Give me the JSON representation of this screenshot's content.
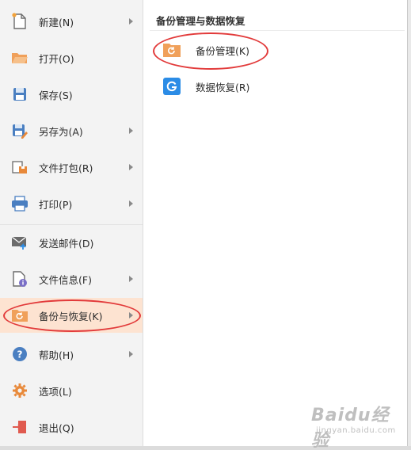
{
  "menu": {
    "items": [
      {
        "label": "新建(N)",
        "icon": "new-file-icon",
        "has_arrow": true
      },
      {
        "label": "打开(O)",
        "icon": "open-folder-icon",
        "has_arrow": false
      },
      {
        "label": "保存(S)",
        "icon": "save-icon",
        "has_arrow": false
      },
      {
        "label": "另存为(A)",
        "icon": "save-as-icon",
        "has_arrow": true
      },
      {
        "label": "文件打包(R)",
        "icon": "package-icon",
        "has_arrow": true
      },
      {
        "label": "打印(P)",
        "icon": "print-icon",
        "has_arrow": true
      },
      {
        "label": "发送邮件(D)",
        "icon": "send-mail-icon",
        "has_arrow": false
      },
      {
        "label": "文件信息(F)",
        "icon": "file-info-icon",
        "has_arrow": true
      },
      {
        "label": "备份与恢复(K)",
        "icon": "backup-restore-icon",
        "has_arrow": true,
        "active": true
      },
      {
        "label": "帮助(H)",
        "icon": "help-icon",
        "has_arrow": true
      },
      {
        "label": "选项(L)",
        "icon": "options-gear-icon",
        "has_arrow": false
      },
      {
        "label": "退出(Q)",
        "icon": "exit-icon",
        "has_arrow": false
      }
    ]
  },
  "submenu": {
    "title": "备份管理与数据恢复",
    "items": [
      {
        "label": "备份管理(K)",
        "icon": "backup-management-icon"
      },
      {
        "label": "数据恢复(R)",
        "icon": "data-recovery-icon"
      }
    ]
  },
  "watermark": {
    "text": "Baidu经验",
    "sub": "jingyan.baidu.com"
  },
  "colors": {
    "active_bg": "#fde3d1",
    "highlight_ellipse": "#e23a3a",
    "folder_orange": "#f0a05a",
    "accent_blue": "#2b8ce6"
  }
}
